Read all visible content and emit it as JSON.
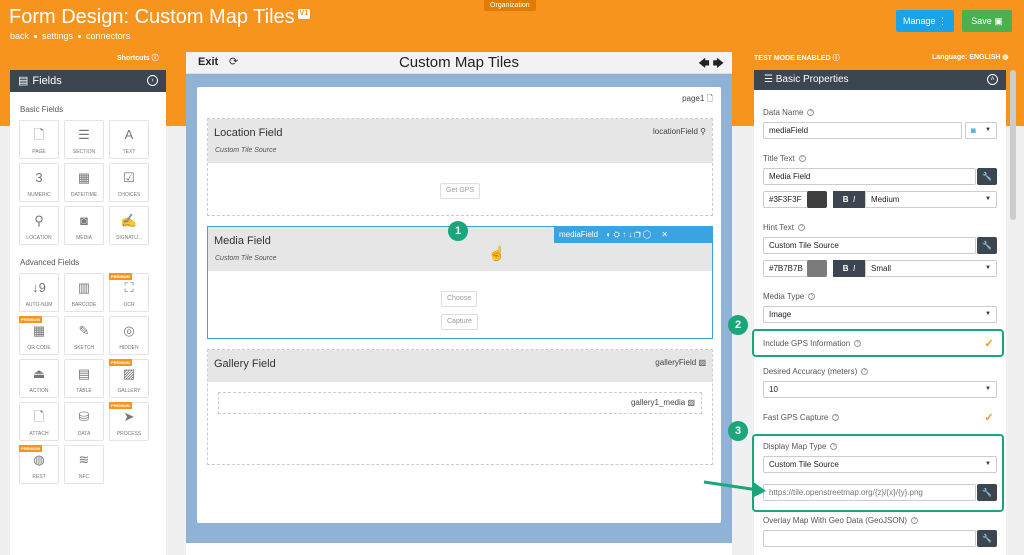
{
  "header": {
    "org_tag": "Organization",
    "title": "Form Design: Custom Map Tiles",
    "version": "V1",
    "crumbs": [
      "back",
      "settings",
      "connectors"
    ],
    "manage_label": "Manage",
    "save_label": "Save",
    "shortcuts": "Shortcuts",
    "test_mode": "TEST MODE ENABLED",
    "language": "Language: ENGLISH"
  },
  "fields_panel": {
    "title": "Fields",
    "basic_title": "Basic Fields",
    "advanced_title": "Advanced Fields",
    "premium": "PREMIUM",
    "basic": [
      {
        "label": "PAGE",
        "glyph": "🗋"
      },
      {
        "label": "SECTION",
        "glyph": "☰"
      },
      {
        "label": "TEXT",
        "glyph": "A"
      },
      {
        "label": "NUMERIC",
        "glyph": "3"
      },
      {
        "label": "DATE/TIME",
        "glyph": "▦"
      },
      {
        "label": "CHOICES",
        "glyph": "☑"
      },
      {
        "label": "LOCATION",
        "glyph": "⚲"
      },
      {
        "label": "MEDIA",
        "glyph": "◙"
      },
      {
        "label": "SIGNATU...",
        "glyph": "✍"
      }
    ],
    "advanced": [
      {
        "label": "AUTO-NUM",
        "glyph": "↓9",
        "premium": false
      },
      {
        "label": "BARCODE",
        "glyph": "▥",
        "premium": false
      },
      {
        "label": "OCR",
        "glyph": "⛶",
        "premium": true
      },
      {
        "label": "QR CODE",
        "glyph": "▦",
        "premium": true
      },
      {
        "label": "SKETCH",
        "glyph": "✎",
        "premium": false
      },
      {
        "label": "HIDDEN",
        "glyph": "◎",
        "premium": false
      },
      {
        "label": "ACTION",
        "glyph": "⏏",
        "premium": false
      },
      {
        "label": "TABLE",
        "glyph": "▤",
        "premium": false
      },
      {
        "label": "GALLERY",
        "glyph": "▨",
        "premium": true
      },
      {
        "label": "ATTACH",
        "glyph": "🗋",
        "premium": false
      },
      {
        "label": "DATA",
        "glyph": "⛁",
        "premium": false
      },
      {
        "label": "PROCESS",
        "glyph": "➤",
        "premium": true
      },
      {
        "label": "REST",
        "glyph": "◍",
        "premium": true
      },
      {
        "label": "NFC",
        "glyph": "≋",
        "premium": false
      }
    ]
  },
  "canvas": {
    "exit": "Exit",
    "title": "Custom Map Tiles",
    "page_label": "page1",
    "location": {
      "title": "Location Field",
      "subtitle": "Custom Tile Source",
      "name": "locationField",
      "button": "Get GPS"
    },
    "media": {
      "title": "Media Field",
      "subtitle": "Custom Tile Source",
      "name": "mediaField",
      "choose": "Choose",
      "capture": "Capture"
    },
    "gallery": {
      "title": "Gallery Field",
      "name": "galleryField",
      "inner": "gallery1_media"
    }
  },
  "props": {
    "title": "Basic Properties",
    "data_name_label": "Data Name",
    "data_name": "mediaField",
    "title_text_label": "Title Text",
    "title_text": "Media Field",
    "title_color": "#3F3F3F",
    "title_size": "Medium",
    "hint_text_label": "Hint Text",
    "hint_text": "Custom Tile Source",
    "hint_color": "#7B7B7B",
    "hint_size": "Small",
    "media_type_label": "Media Type",
    "media_type": "Image",
    "gps_label": "Include GPS Information",
    "accuracy_label": "Desired Accuracy (meters)",
    "accuracy": "10",
    "fast_gps_label": "Fast GPS Capture",
    "map_type_label": "Display Map Type",
    "map_type": "Custom Tile Source",
    "tile_url": "https://tile.openstreetmap.org/{z}/{x}/{y}.png",
    "overlay_label": "Overlay Map With Geo Data (GeoJSON)"
  },
  "badges": [
    "1",
    "2",
    "3"
  ],
  "colors": {
    "brand": "#f7941d",
    "highlight": "#1aa67b",
    "select": "#3ba3e0",
    "dark": "#3c4650"
  }
}
